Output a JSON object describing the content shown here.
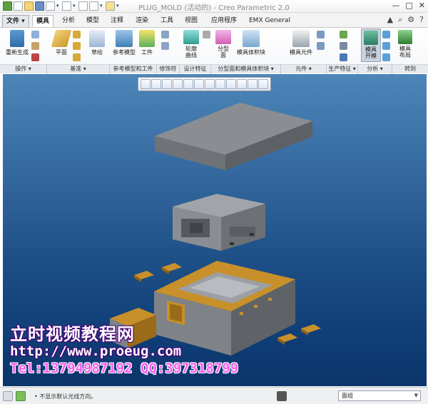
{
  "app": {
    "title": "PLUG_MOLD (活动的) - Creo Parametric 2.0"
  },
  "title_controls": {
    "minimize": "—",
    "maximize": "□",
    "close": "✕"
  },
  "tabs": [
    {
      "label": "文件 ▾"
    },
    {
      "label": "模具"
    },
    {
      "label": "分析"
    },
    {
      "label": "模型"
    },
    {
      "label": "注释"
    },
    {
      "label": "渲染"
    },
    {
      "label": "工具"
    },
    {
      "label": "视图"
    },
    {
      "label": "应用程序"
    },
    {
      "label": "EMX General"
    }
  ],
  "ribbon": {
    "regenerate": "重新生成",
    "plane": "平面",
    "sketch": "草绘",
    "ref_model": "参考模型",
    "workpiece": "工件",
    "silhouette": "轮廓\n曲线",
    "parting_surface": "分型\n面",
    "mold_volume": "模具体积块",
    "mold_component": "模具元件",
    "mold_open": "模具\n开模",
    "mold_layout": "模具\n布局"
  },
  "groups": {
    "operations": "操作 ▾",
    "datum": "基准 ▾",
    "ref_workpiece": "参考模型和工件",
    "modifiers": "修饰符",
    "design_features": "设计特征",
    "parting": "分型面和模具体积块 ▾",
    "components": "元件 ▾",
    "production": "生产特征 ▾",
    "analysis": "分析 ▾",
    "goto": "转到"
  },
  "watermark": {
    "line1": "立时视频教程网",
    "line2": "http://www.proeug.com",
    "line3": "Tel:13794987192  QQ:397318799"
  },
  "status": {
    "message": "• 不显示默认光线方向。",
    "filter_value": "面组"
  },
  "colors": {
    "viewport_top": "#4e86b9",
    "viewport_bottom": "#0b356b",
    "part_gray": "#7f8387",
    "part_gold": "#c8902a"
  }
}
